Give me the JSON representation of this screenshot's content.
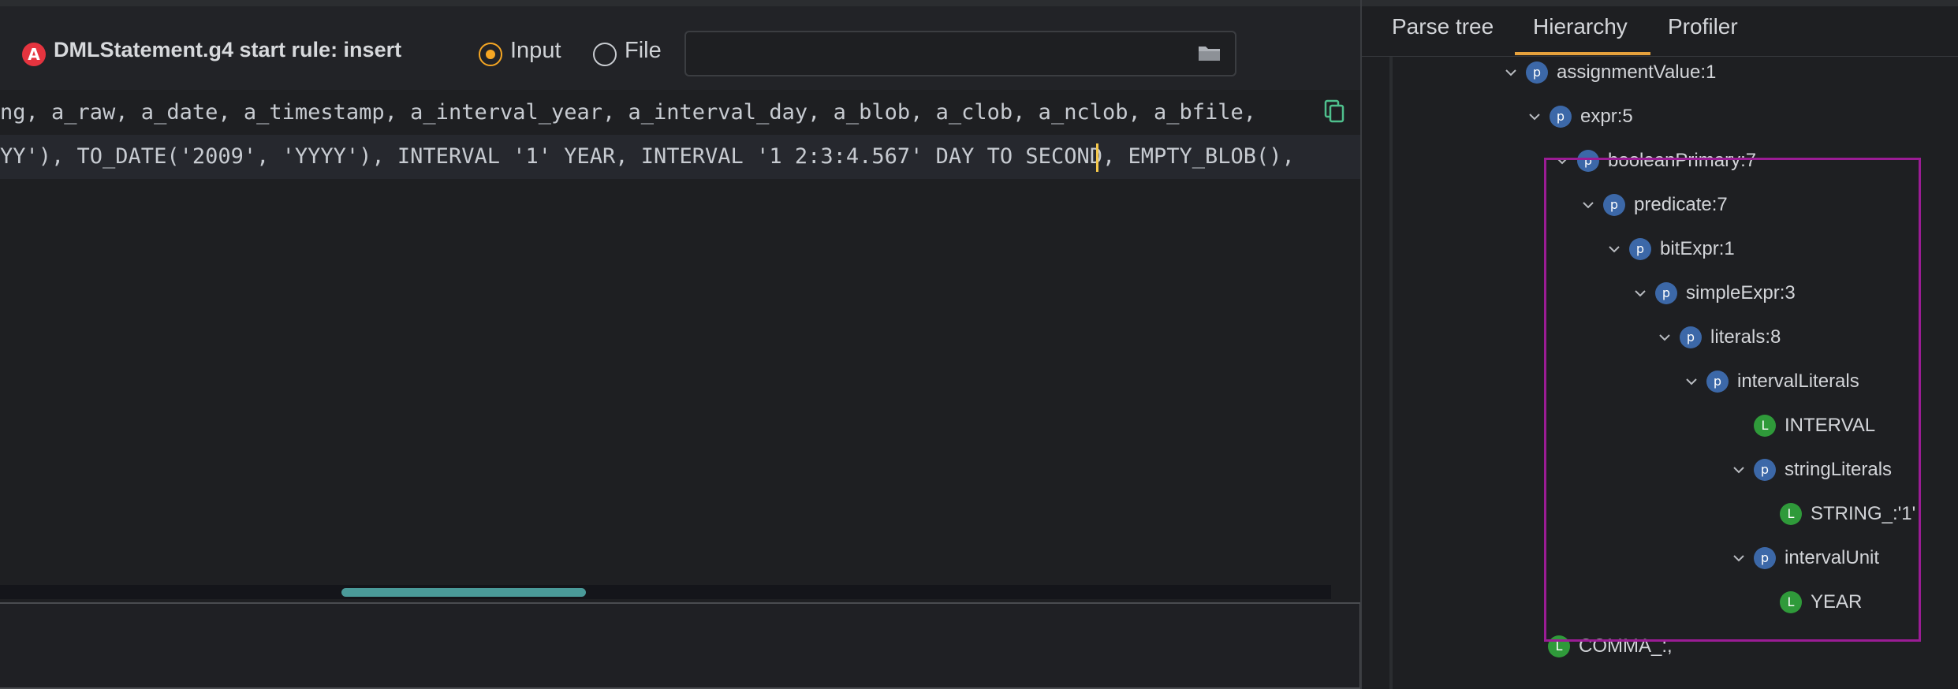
{
  "toolbar": {
    "grammar_title": "DMLStatement.g4 start rule: insert",
    "input_label": "Input",
    "file_label": "File",
    "file_value": ""
  },
  "editor": {
    "line_1": "ng, a_raw, a_date, a_timestamp, a_interval_year, a_interval_day, a_blob, a_clob, a_nclob, a_bfile, ",
    "line_2": "YY'), TO_DATE('2009', 'YYYY'), INTERVAL '1' YEAR, INTERVAL '1 2:3:4.567' DAY TO SECOND, EMPTY_BLOB(), "
  },
  "tabs": {
    "parse_tree": "Parse tree",
    "hierarchy": "Hierarchy",
    "profiler": "Profiler",
    "active": "Hierarchy"
  },
  "tree": [
    {
      "label": "assignmentValue:1",
      "kind": "p",
      "expanded": true
    },
    {
      "label": "expr:5",
      "kind": "p",
      "expanded": true
    },
    {
      "label": "booleanPrimary:7",
      "kind": "p",
      "expanded": true
    },
    {
      "label": "predicate:7",
      "kind": "p",
      "expanded": true
    },
    {
      "label": "bitExpr:1",
      "kind": "p",
      "expanded": true
    },
    {
      "label": "simpleExpr:3",
      "kind": "p",
      "expanded": true
    },
    {
      "label": "literals:8",
      "kind": "p",
      "expanded": true
    },
    {
      "label": "intervalLiterals",
      "kind": "p",
      "expanded": true
    },
    {
      "label": "INTERVAL",
      "kind": "L"
    },
    {
      "label": "stringLiterals",
      "kind": "p",
      "expanded": true
    },
    {
      "label": "STRING_:'1'",
      "kind": "L"
    },
    {
      "label": "intervalUnit",
      "kind": "p",
      "expanded": true
    },
    {
      "label": "YEAR",
      "kind": "L"
    },
    {
      "label": "COMMA_:,",
      "kind": "L"
    }
  ],
  "colors": {
    "accent": "#f5a623",
    "tab_underline": "#e6a13c",
    "parser_badge": "#3c68a8",
    "lexer_badge": "#2f9a3a",
    "highlight": "#9b1c95",
    "scrollbar": "#4a9a99"
  },
  "icons": [
    "grammar-error-icon",
    "folder-icon",
    "copy-icon",
    "chevron-down-icon"
  ]
}
